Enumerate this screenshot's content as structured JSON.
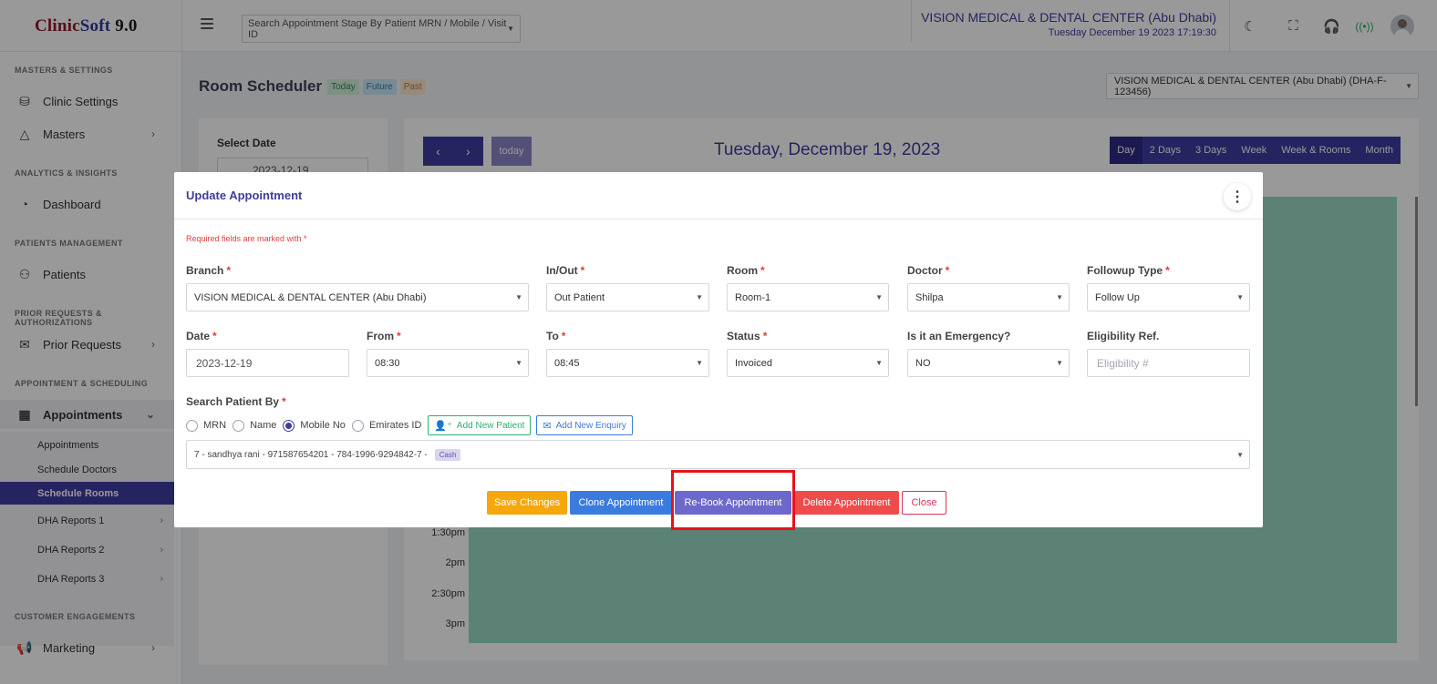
{
  "header": {
    "logo": {
      "part1": "Clinic",
      "part2": "Soft",
      "part3": " 9.0"
    },
    "search_placeholder": "Search Appointment Stage By Patient MRN / Mobile / Visit ID",
    "clinic_name": "VISION MEDICAL & DENTAL CENTER (Abu Dhabi)",
    "datetime": "Tuesday December 19 2023 17:19:30",
    "icons": [
      "menu-icon",
      "moon-icon",
      "fullscreen-icon",
      "headset-icon",
      "signal-icon",
      "user-avatar"
    ]
  },
  "sidebar": {
    "sections": [
      {
        "title": "MASTERS & SETTINGS"
      },
      {
        "title": "ANALYTICS & INSIGHTS"
      },
      {
        "title": "PATIENTS MANAGEMENT"
      },
      {
        "title": "PRIOR REQUESTS & AUTHORIZATIONS"
      },
      {
        "title": "APPOINTMENT & SCHEDULING"
      },
      {
        "title": "CUSTOMER ENGAGEMENTS"
      }
    ],
    "items": [
      {
        "label": "Clinic Settings",
        "icon": "database-icon"
      },
      {
        "label": "Masters",
        "icon": "shapes-icon"
      },
      {
        "label": "Dashboard",
        "icon": "gauge-icon"
      },
      {
        "label": "Patients",
        "icon": "users-icon"
      },
      {
        "label": "Prior Requests",
        "icon": "envelope-icon"
      },
      {
        "label": "Appointments",
        "icon": "calendar-icon"
      },
      {
        "label": "Marketing",
        "icon": "megaphone-icon"
      }
    ],
    "sub_items": [
      {
        "label": "Appointments"
      },
      {
        "label": "Schedule Doctors"
      },
      {
        "label": "Schedule Rooms",
        "active": true
      },
      {
        "label": "DHA Reports 1"
      },
      {
        "label": "DHA Reports 2"
      },
      {
        "label": "DHA Reports 3"
      }
    ]
  },
  "page": {
    "title": "Room Scheduler",
    "tags": {
      "today": "Today",
      "future": "Future",
      "past": "Past"
    },
    "branch_select": "VISION MEDICAL & DENTAL CENTER (Abu Dhabi) (DHA-F-123456)",
    "select_date_label": "Select Date",
    "select_date_value": "2023-12-19"
  },
  "calendar": {
    "prev": "‹",
    "next": "›",
    "today_label": "today",
    "title": "Tuesday, December 19, 2023",
    "views": [
      "Day",
      "2 Days",
      "3 Days",
      "Week",
      "Week & Rooms",
      "Month"
    ],
    "active_view": "Day",
    "time_slots": [
      "1:30pm",
      "2pm",
      "2:30pm",
      "3pm"
    ],
    "event_color": "#9ad8c4"
  },
  "modal": {
    "title": "Update Appointment",
    "required_note": "Required fields are marked with *",
    "fields": {
      "branch": {
        "label": "Branch",
        "value": "VISION MEDICAL & DENTAL CENTER (Abu Dhabi)"
      },
      "inout": {
        "label": "In/Out",
        "value": "Out Patient"
      },
      "room": {
        "label": "Room",
        "value": "Room-1"
      },
      "doctor": {
        "label": "Doctor",
        "value": "Shilpa"
      },
      "followup": {
        "label": "Followup Type",
        "value": "Follow Up"
      },
      "date": {
        "label": "Date",
        "value": "2023-12-19"
      },
      "from": {
        "label": "From",
        "value": "08:30"
      },
      "to": {
        "label": "To",
        "value": "08:45"
      },
      "status": {
        "label": "Status",
        "value": "Invoiced"
      },
      "emergency": {
        "label": "Is it an Emergency?",
        "value": "NO"
      },
      "eligibility": {
        "label": "Eligibility Ref.",
        "placeholder": "Eligibility #"
      }
    },
    "search_by": {
      "label": "Search Patient By",
      "options": [
        "MRN",
        "Name",
        "Mobile No",
        "Emirates ID"
      ],
      "selected": "Mobile No",
      "add_patient": "Add New Patient",
      "add_enquiry": "Add New Enquiry"
    },
    "patient": {
      "text": "7 - sandhya rani - 971587654201 - 784-1996-9294842-7 -",
      "badge": "Cash"
    },
    "buttons": {
      "save": "Save Changes",
      "clone": "Clone Appointment",
      "rebook": "Re-Book Appointment",
      "delete": "Delete Appointment",
      "close": "Close"
    }
  },
  "colors": {
    "primary": "#3f3ca0",
    "save": "#f5a70b",
    "clone": "#3a7be0",
    "rebook": "#6d68cc",
    "delete": "#ef4b4b",
    "highlight": "#e8111b"
  }
}
